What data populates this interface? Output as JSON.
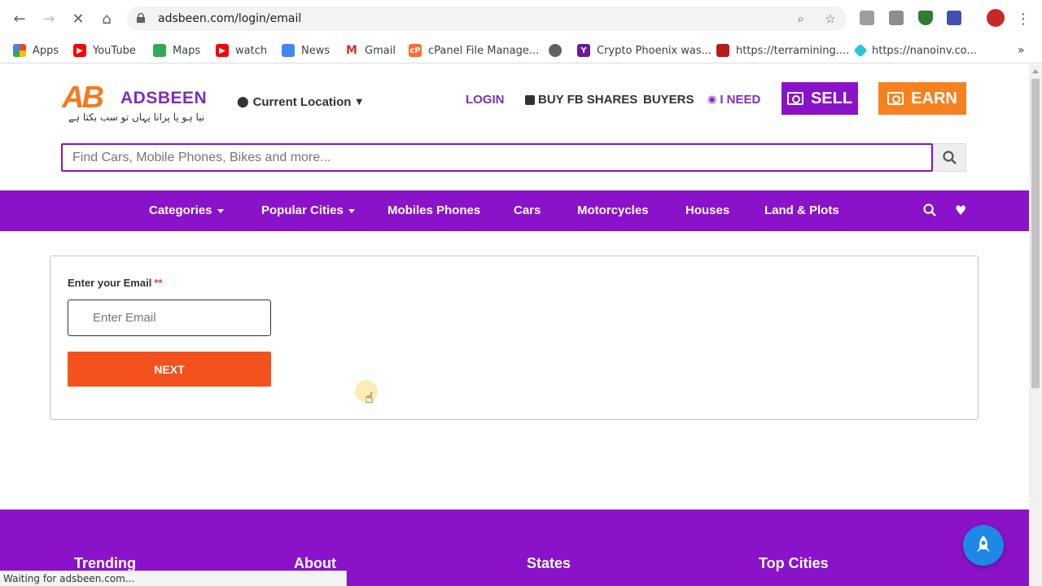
{
  "browser": {
    "url": "adsbeen.com/login/email",
    "bookmarks": [
      "Apps",
      "YouTube",
      "Maps",
      "watch",
      "News",
      "Gmail",
      "cPanel File Manage...",
      "Crypto Phoenix was...",
      "https://terramining....",
      "https://nanoinv.co..."
    ],
    "status": "Waiting for adsbeen.com..."
  },
  "header": {
    "logo_name": "ADSBEEN",
    "logo_tagline": "نیا ہو یا پرانا یہاں تو سب بکتا ہے",
    "location": "Current Location",
    "nav": [
      "LOGIN",
      "BUY FB SHARES",
      "BUYERS",
      "I NEED"
    ],
    "sell": "SELL",
    "earn": "EARN"
  },
  "search": {
    "placeholder": "Find Cars, Mobile Phones, Bikes and more..."
  },
  "menu": [
    "Categories",
    "Popular Cities",
    "Mobiles Phones",
    "Cars",
    "Motorcycles",
    "Houses",
    "Land & Plots"
  ],
  "form": {
    "label": "Enter your Email",
    "required": "**",
    "placeholder": "Enter Email",
    "next": "NEXT"
  },
  "footer": {
    "headings": [
      "Trending",
      "About",
      "States",
      "Top Cities"
    ]
  },
  "colors": {
    "brand_purple": "#8a12c8",
    "brand_orange": "#f5821f",
    "next_button": "#f4511e"
  }
}
